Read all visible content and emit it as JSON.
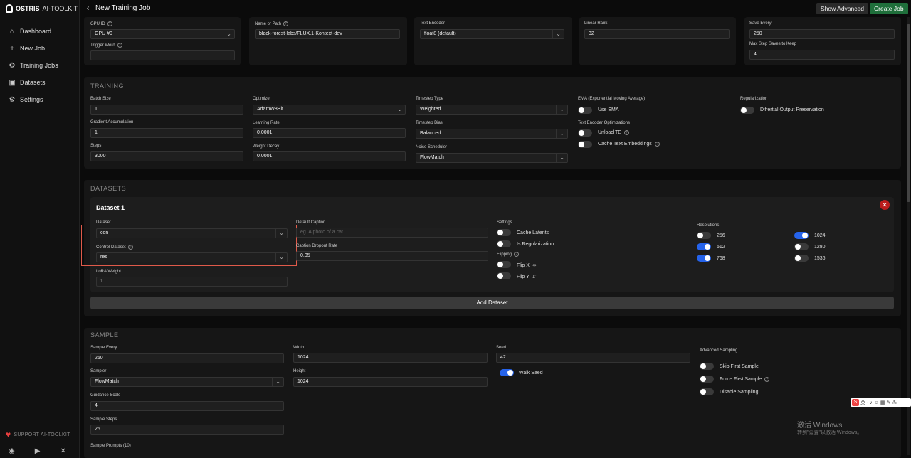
{
  "app": {
    "brand": "OSTRIS",
    "brand_sub": "AI-TOOLKIT",
    "page_title": "New Training Job"
  },
  "header": {
    "show_advanced": "Show Advanced",
    "create_job": "Create Job"
  },
  "sidebar": {
    "items": [
      {
        "label": "Dashboard",
        "icon": "home-icon"
      },
      {
        "label": "New Job",
        "icon": "plus-icon"
      },
      {
        "label": "Training Jobs",
        "icon": "gear-bolt-icon"
      },
      {
        "label": "Datasets",
        "icon": "images-icon"
      },
      {
        "label": "Settings",
        "icon": "gear-icon"
      }
    ],
    "support": "SUPPORT AI-TOOLKIT"
  },
  "top": {
    "gpu_label": "GPU ID",
    "gpu_value": "GPU #0",
    "trigger_label": "Trigger Word",
    "trigger_value": "",
    "model_label": "Name or Path",
    "model_value": "black-forest-labs/FLUX.1-Kontext-dev",
    "te_label": "Text Encoder",
    "te_value": "float8 (default)",
    "rank_label": "Linear Rank",
    "rank_value": "32",
    "save_every_label": "Save Every",
    "save_every_value": "250",
    "max_saves_label": "Max Step Saves to Keep",
    "max_saves_value": "4"
  },
  "training": {
    "title": "TRAINING",
    "batch_label": "Batch Size",
    "batch_value": "1",
    "grad_label": "Gradient Accumulation",
    "grad_value": "1",
    "steps_label": "Steps",
    "steps_value": "3000",
    "optimizer_label": "Optimizer",
    "optimizer_value": "AdamW8Bit",
    "lr_label": "Learning Rate",
    "lr_value": "0.0001",
    "wd_label": "Weight Decay",
    "wd_value": "0.0001",
    "ts_type_label": "Timestep Type",
    "ts_type_value": "Weighted",
    "ts_bias_label": "Timestep Bias",
    "ts_bias_value": "Balanced",
    "noise_label": "Noise Scheduler",
    "noise_value": "FlowMatch",
    "ema_label": "EMA (Exponential Moving Average)",
    "use_ema": "Use EMA",
    "teo_label": "Text Encoder Optimizations",
    "unload_te": "Unload TE",
    "cache_te": "Cache Text Embeddings",
    "reg_label": "Regularization",
    "dop": "Differtial Output Preservation"
  },
  "datasets": {
    "title": "DATASETS",
    "card_title": "Dataset 1",
    "dataset_label": "Dataset",
    "dataset_value": "con",
    "control_label": "Control Dataset",
    "control_value": "res",
    "lora_label": "LoRA Weight",
    "lora_value": "1",
    "caption_label": "Default Caption",
    "caption_placeholder": "eg. A photo of a cat",
    "dropout_label": "Caption Dropout Rate",
    "dropout_value": "0.05",
    "settings_label": "Settings",
    "cache_latents": "Cache Latents",
    "is_reg": "Is Regularization",
    "flipping_label": "Flipping",
    "flip_x": "Flip X",
    "flip_y": "Flip Y",
    "resolutions_label": "Resolutions",
    "resolutions": [
      {
        "label": "256",
        "on": false
      },
      {
        "label": "512",
        "on": true
      },
      {
        "label": "768",
        "on": true
      },
      {
        "label": "1024",
        "on": true
      },
      {
        "label": "1280",
        "on": false
      },
      {
        "label": "1536",
        "on": false
      }
    ],
    "add": "Add Dataset"
  },
  "sample": {
    "title": "SAMPLE",
    "every_label": "Sample Every",
    "every_value": "250",
    "sampler_label": "Sampler",
    "sampler_value": "FlowMatch",
    "guidance_label": "Guidance Scale",
    "guidance_value": "4",
    "steps_label": "Sample Steps",
    "steps_value": "25",
    "prompts_label": "Sample Prompts (10)",
    "width_label": "Width",
    "width_value": "1024",
    "height_label": "Height",
    "height_value": "1024",
    "seed_label": "Seed",
    "seed_value": "42",
    "walk_seed": "Walk Seed",
    "adv_label": "Advanced Sampling",
    "skip_first": "Skip First Sample",
    "force_first": "Force First Sample",
    "disable": "Disable Sampling"
  },
  "os": {
    "activate_title": "激活 Windows",
    "activate_sub": "转到\"设置\"以激活 Windows。",
    "ime": "英"
  }
}
